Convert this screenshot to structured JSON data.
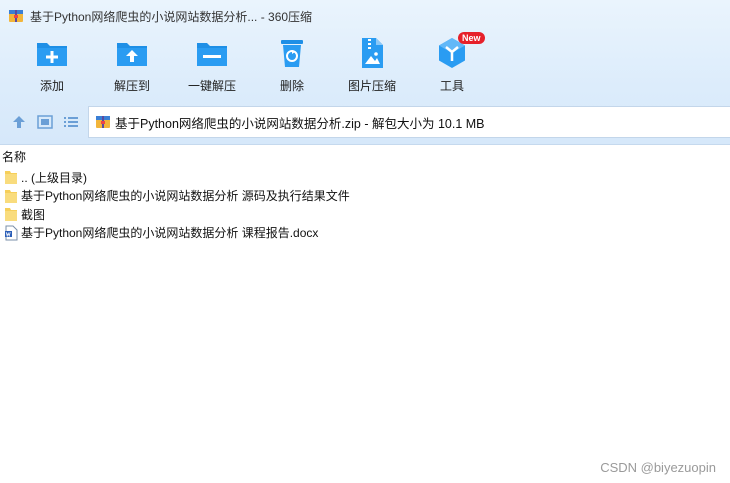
{
  "window": {
    "title": "基于Python网络爬虫的小说网站数据分析... - 360压缩",
    "icon": "archive-app-icon"
  },
  "toolbar": {
    "items": [
      {
        "label": "添加",
        "icon": "add-folder-icon"
      },
      {
        "label": "解压到",
        "icon": "extract-to-icon"
      },
      {
        "label": "一键解压",
        "icon": "one-click-extract-icon"
      },
      {
        "label": "删除",
        "icon": "recycle-bin-icon"
      },
      {
        "label": "图片压缩",
        "icon": "image-compress-icon"
      },
      {
        "label": "工具",
        "icon": "tools-icon",
        "badge": "New"
      }
    ]
  },
  "nav": {
    "address": "基于Python网络爬虫的小说网站数据分析.zip - 解包大小为 10.1 MB"
  },
  "list": {
    "header_name": "名称",
    "rows": [
      {
        "name": ".. (上级目录)",
        "icon": "folder-icon"
      },
      {
        "name": "基于Python网络爬虫的小说网站数据分析 源码及执行结果文件",
        "icon": "folder-icon"
      },
      {
        "name": "截图",
        "icon": "folder-icon"
      },
      {
        "name": "基于Python网络爬虫的小说网站数据分析 课程报告.docx",
        "icon": "word-doc-icon"
      }
    ]
  },
  "watermark": "CSDN @biyezuopin",
  "colors": {
    "accent": "#1e8fe6",
    "badge": "#e6202a",
    "folder": "#f6cf5a"
  }
}
